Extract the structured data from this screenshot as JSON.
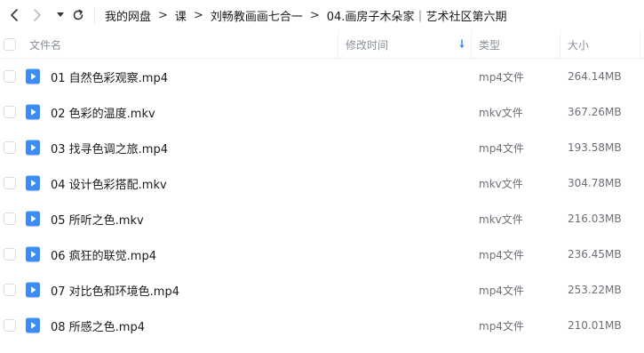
{
  "nav": {
    "back_icon": "chevron-left-icon",
    "forward_icon": "chevron-right-icon",
    "dropdown_icon": "caret-down-icon",
    "refresh_icon": "refresh-icon"
  },
  "breadcrumb": {
    "items": [
      "我的网盘",
      "课",
      "刘畅教画画七合一",
      "04.画房子木朵家｜艺术社区第六期"
    ],
    "separator": ">"
  },
  "table": {
    "headers": {
      "name": "文件名",
      "modified": "修改时间",
      "type": "类型",
      "size": "大小"
    },
    "sort_icon": "sort-down-arrow-icon",
    "accent_color": "#3d8cf5",
    "rows": [
      {
        "name": "01 自然色彩观察.mp4",
        "type": "mp4文件",
        "size": "264.14MB"
      },
      {
        "name": "02 色彩的温度.mkv",
        "type": "mkv文件",
        "size": "367.26MB"
      },
      {
        "name": "03 找寻色调之旅.mp4",
        "type": "mp4文件",
        "size": "193.58MB"
      },
      {
        "name": "04 设计色彩搭配.mkv",
        "type": "mkv文件",
        "size": "304.78MB"
      },
      {
        "name": "05 所听之色.mkv",
        "type": "mkv文件",
        "size": "216.03MB"
      },
      {
        "name": "06 疯狂的联觉.mp4",
        "type": "mp4文件",
        "size": "236.45MB"
      },
      {
        "name": "07 对比色和环境色.mp4",
        "type": "mp4文件",
        "size": "253.22MB"
      },
      {
        "name": "08 所感之色.mp4",
        "type": "mp4文件",
        "size": "210.01MB"
      }
    ]
  }
}
